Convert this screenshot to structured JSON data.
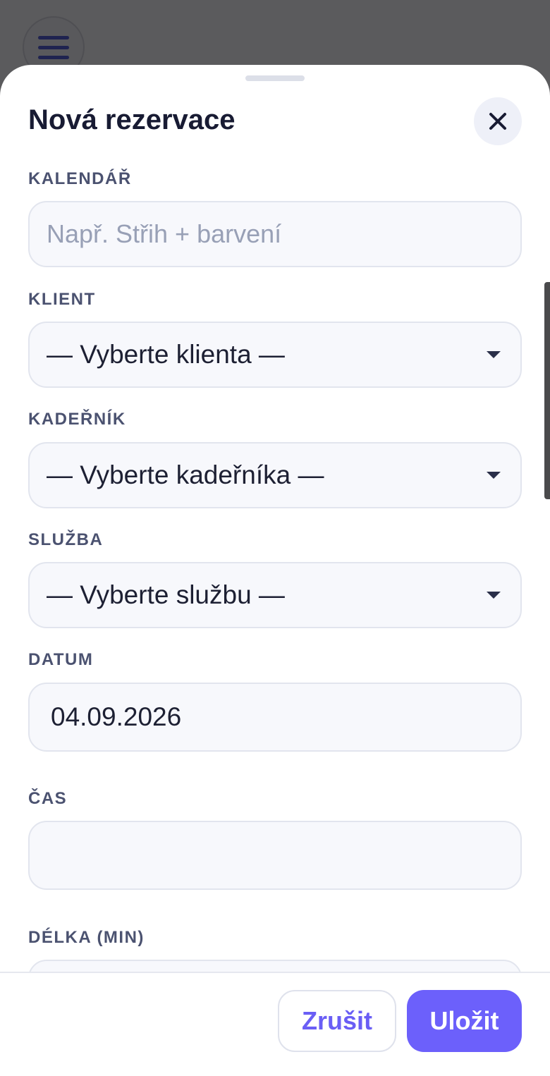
{
  "header": {
    "title": "Nová rezervace"
  },
  "fields": {
    "calendar": {
      "label": "KALENDÁŘ",
      "placeholder": "Např. Střih + barvení"
    },
    "client": {
      "label": "KLIENT",
      "value": "— Vyberte klienta —"
    },
    "hairdresser": {
      "label": "KADEŘNÍK",
      "value": "— Vyberte kadeřníka —"
    },
    "service": {
      "label": "SLUŽBA",
      "value": "— Vyberte službu —"
    },
    "date": {
      "label": "DATUM",
      "value": "04.09.2026"
    },
    "time": {
      "label": "ČAS",
      "value": ""
    },
    "duration": {
      "label": "DÉLKA (MIN)",
      "value": ""
    }
  },
  "footer": {
    "cancel_label": "Zrušit",
    "save_label": "Uložit"
  },
  "colors": {
    "accent": "#6c60fb",
    "title": "#181b33",
    "label": "#4b5270"
  },
  "icons": {
    "menu": "menu-icon",
    "close": "close-icon",
    "dropdown": "chevron-down-icon"
  }
}
